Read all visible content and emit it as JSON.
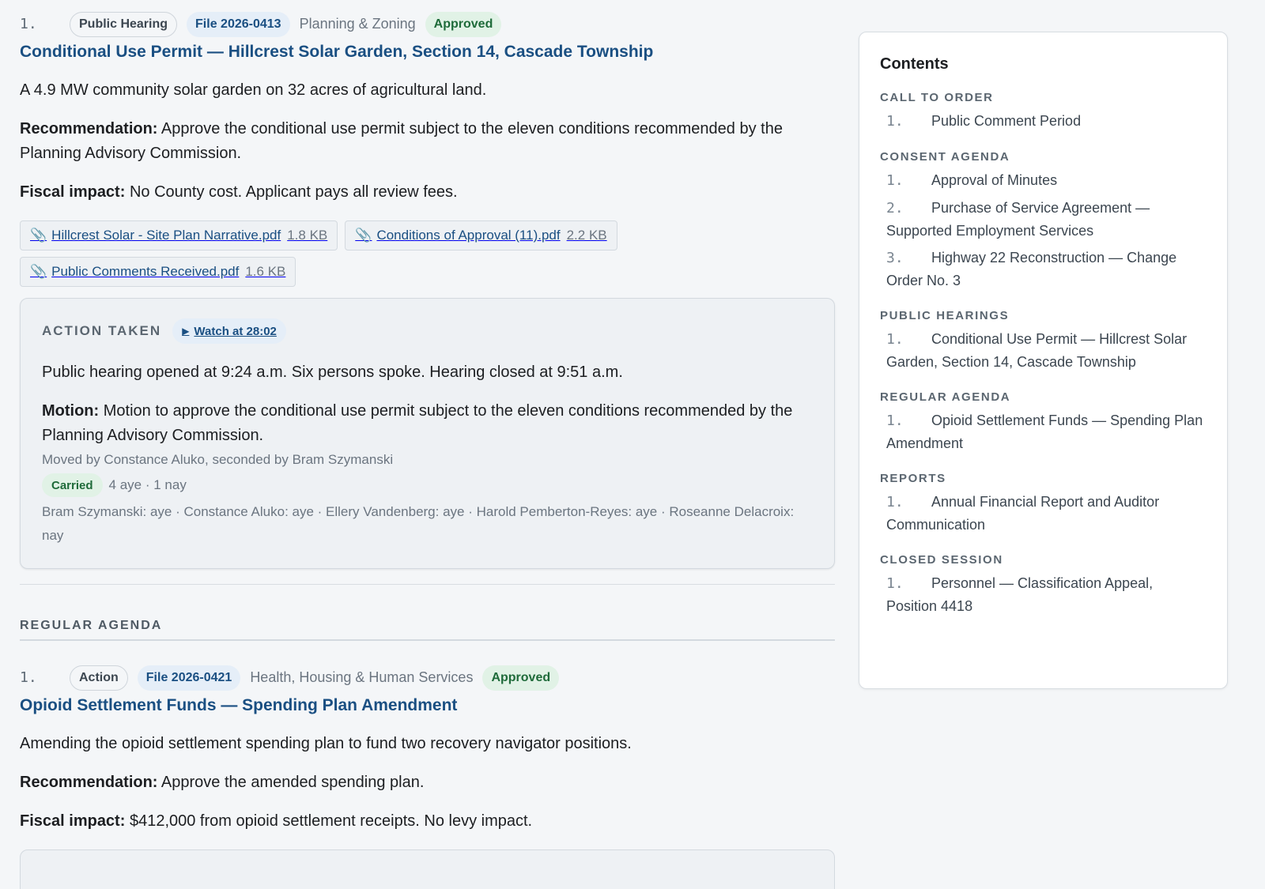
{
  "items": [
    {
      "number": "1.",
      "type": "Public Hearing",
      "file": "File 2026-0413",
      "department": "Planning & Zoning",
      "status": "Approved",
      "title": "Conditional Use Permit — Hillcrest Solar Garden, Section 14, Cascade Township",
      "summary": "A 4.9 MW community solar garden on 32 acres of agricultural land.",
      "recommendation_label": "Recommendation:",
      "recommendation": "Approve the conditional use permit subject to the eleven conditions recommended by the Planning Advisory Commission.",
      "fiscal_label": "Fiscal impact:",
      "fiscal": "No County cost. Applicant pays all review fees.",
      "attachments": [
        {
          "icon": "paperclip-icon",
          "name": "Hillcrest Solar - Site Plan Narrative.pdf",
          "size": "1.8 KB"
        },
        {
          "icon": "paperclip-icon",
          "name": "Conditions of Approval (11).pdf",
          "size": "2.2 KB"
        },
        {
          "icon": "paperclip-icon",
          "name": "Public Comments Received.pdf",
          "size": "1.6 KB"
        }
      ],
      "action": {
        "label": "ACTION TAKEN",
        "watch_label": "Watch at 28:02",
        "play_icon": "play-icon",
        "note": "Public hearing opened at 9:24 a.m. Six persons spoke. Hearing closed at 9:51 a.m.",
        "motion_label": "Motion:",
        "motion": "Motion to approve the conditional use permit subject to the eleven conditions recommended by the Planning Advisory Commission.",
        "moved_by": "Moved by Constance Aluko, seconded by Bram Szymanski",
        "result": "Carried",
        "tally": "4 aye · 1 nay",
        "roll_call": "Bram Szymanski: aye · Constance Aluko: aye · Ellery Vandenberg: aye · Harold Pemberton-Reyes: aye · Roseanne Delacroix: nay"
      }
    },
    {
      "number": "1.",
      "type": "Action",
      "file": "File 2026-0421",
      "department": "Health, Housing & Human Services",
      "status": "Approved",
      "title": "Opioid Settlement Funds — Spending Plan Amendment",
      "summary": "Amending the opioid settlement spending plan to fund two recovery navigator positions.",
      "recommendation_label": "Recommendation:",
      "recommendation": "Approve the amended spending plan.",
      "fiscal_label": "Fiscal impact:",
      "fiscal": "$412,000 from opioid settlement receipts. No levy impact."
    }
  ],
  "section_regular": "REGULAR AGENDA",
  "toc": {
    "title": "Contents",
    "sections": [
      {
        "label": "CALL TO ORDER",
        "entries": [
          {
            "n": "1.",
            "text": "Public Comment Period"
          }
        ]
      },
      {
        "label": "CONSENT AGENDA",
        "entries": [
          {
            "n": "1.",
            "text": "Approval of Minutes"
          },
          {
            "n": "2.",
            "text": "Purchase of Service Agreement — Supported Employment Services"
          },
          {
            "n": "3.",
            "text": "Highway 22 Reconstruction — Change Order No. 3"
          }
        ]
      },
      {
        "label": "PUBLIC HEARINGS",
        "entries": [
          {
            "n": "1.",
            "text": "Conditional Use Permit — Hillcrest Solar Garden, Section 14, Cascade Township"
          }
        ]
      },
      {
        "label": "REGULAR AGENDA",
        "entries": [
          {
            "n": "1.",
            "text": "Opioid Settlement Funds — Spending Plan Amendment"
          }
        ]
      },
      {
        "label": "REPORTS",
        "entries": [
          {
            "n": "1.",
            "text": "Annual Financial Report and Auditor Communication"
          }
        ]
      },
      {
        "label": "CLOSED SESSION",
        "entries": [
          {
            "n": "1.",
            "text": "Personnel — Classification Appeal, Position 4418"
          }
        ]
      }
    ]
  }
}
